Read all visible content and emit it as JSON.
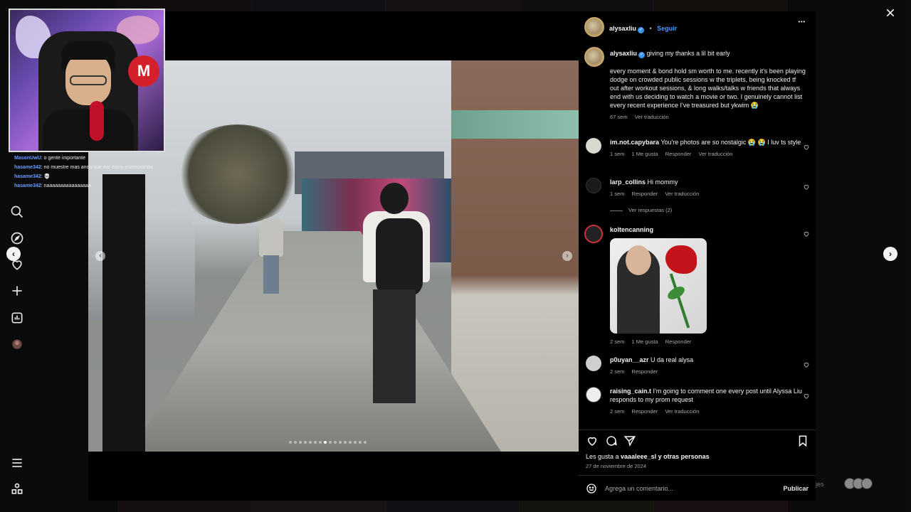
{
  "stream_chat": [
    {
      "user": "MasonUwU",
      "message": "o gente importante"
    },
    {
      "user": "hasame342",
      "message": "no muestre mas ando que me estoy enamorando"
    },
    {
      "user": "hasame342",
      "message": "💀"
    },
    {
      "user": "hasame342",
      "message": "naaaaaaaaaaaaaaaa"
    }
  ],
  "post": {
    "header": {
      "username": "alysaxliu",
      "separator": "•",
      "follow_label": "Seguir",
      "more_label": "•••"
    },
    "caption": {
      "username": "alysaxliu",
      "first_line": "giving my thanks a lil bit early",
      "body": "every moment & bond hold sm worth to me. recently it's been playing dodge on crowded public sessions w the triplets, being knocked tf out after workout sessions, & long walks/talks w friends that always end with us deciding to watch a movie or two. I genuinely cannot list every recent experience I've treasured but ykwim 😭",
      "time": "67 sem",
      "translate": "Ver traducción"
    },
    "comments": [
      {
        "username": "im.not.capybara",
        "text": "You're photos are so nostalgic 😭 😭 I luv ts style",
        "time": "1 sem",
        "likes": "1 Me gusta",
        "reply": "Responder",
        "translate": "Ver traducción"
      },
      {
        "username": "larp_collins",
        "text": "Hi mommy",
        "time": "1 sem",
        "reply": "Responder",
        "translate": "Ver traducción",
        "view_replies": "Ver respuestas (2)"
      },
      {
        "username": "koltencanning",
        "text": "",
        "time": "2 sem",
        "likes": "1 Me gusta",
        "reply": "Responder"
      },
      {
        "username": "p0uyan__azr",
        "text": "U da real alysa",
        "time": "2 sem",
        "reply": "Responder"
      },
      {
        "username": "raising_cain.t",
        "text": "I'm going to comment one every post until Alyssa Liu responds to my prom request",
        "time": "2 sem",
        "reply": "Responder",
        "translate": "Ver traducción"
      }
    ],
    "likes_prefix": "Les gusta a ",
    "likes_user": "vaaaleee_sl",
    "likes_suffix": " y otras personas",
    "date": "27 de noviembre de 2024",
    "add_comment_placeholder": "Agrega un comentario...",
    "publish_label": "Publicar",
    "carousel": {
      "count": 16,
      "active_index": 7
    }
  },
  "background": {
    "partial_text": "jes"
  },
  "icons": {
    "left_nav": [
      "search-icon",
      "explore-icon",
      "heart-icon",
      "create-icon",
      "dashboard-icon",
      "profile-icon",
      "menu-icon",
      "apps-icon"
    ],
    "close": "close-icon",
    "prev": "chevron-left-icon",
    "next": "chevron-right-icon"
  }
}
